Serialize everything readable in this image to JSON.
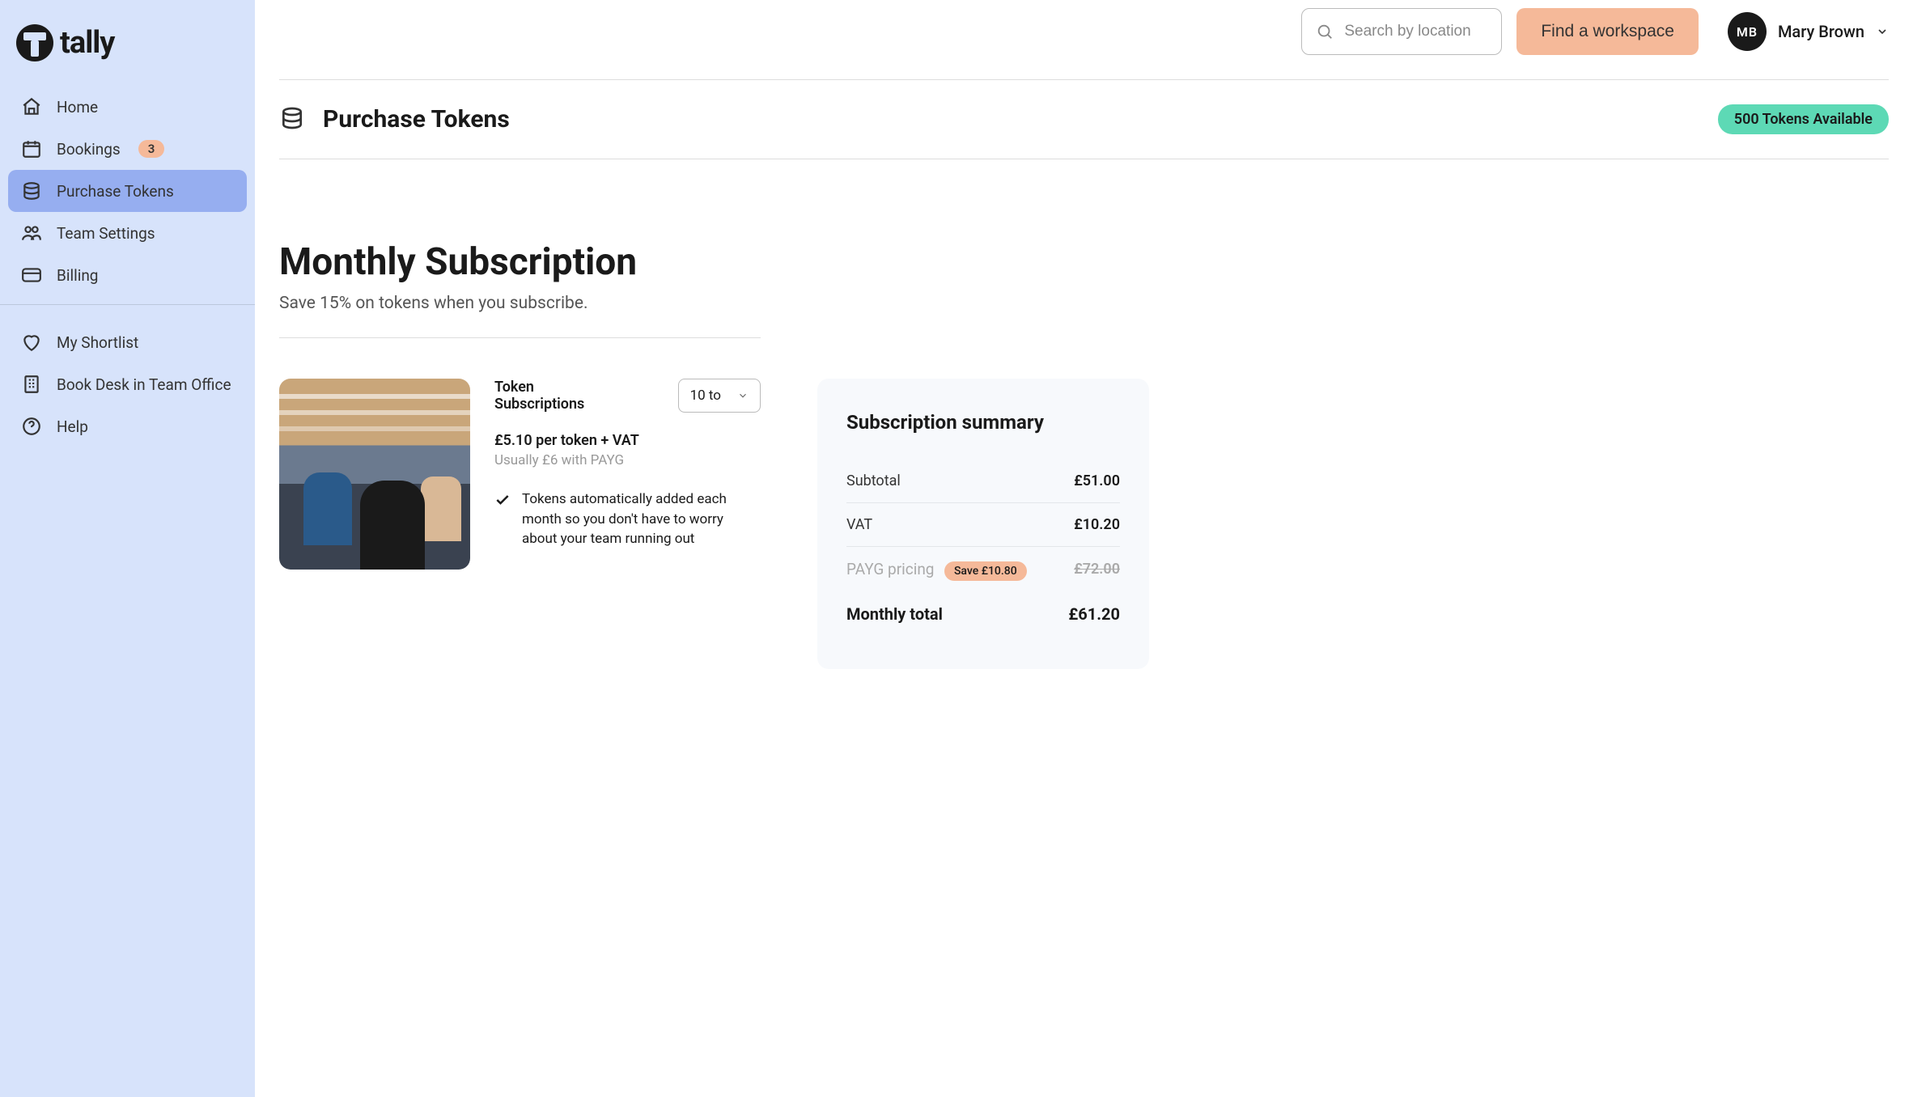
{
  "brand": {
    "name": "tally"
  },
  "sidebar": {
    "items": [
      {
        "label": "Home",
        "name": "home"
      },
      {
        "label": "Bookings",
        "name": "bookings",
        "badge": "3"
      },
      {
        "label": "Purchase Tokens",
        "name": "purchase-tokens",
        "active": true
      },
      {
        "label": "Team Settings",
        "name": "team-settings"
      },
      {
        "label": "Billing",
        "name": "billing"
      }
    ],
    "items2": [
      {
        "label": "My Shortlist",
        "name": "shortlist"
      },
      {
        "label": "Book Desk in Team Office",
        "name": "book-desk"
      },
      {
        "label": "Help",
        "name": "help"
      }
    ]
  },
  "topbar": {
    "search_placeholder": "Search by location",
    "cta": "Find a workspace",
    "user_initials": "MB",
    "user_name": "Mary Brown"
  },
  "page": {
    "title": "Purchase Tokens",
    "token_status": "500 Tokens Available"
  },
  "subscription": {
    "title": "Monthly Subscription",
    "subtitle": "Save 15% on tokens when you subscribe.",
    "token_label": "Token Subscriptions",
    "select_value": "10 to",
    "price_line": "£5.10 per token + VAT",
    "price_usual": "Usually £6 with PAYG",
    "feature1": "Tokens automatically added each month so you don't have to worry about your team running out"
  },
  "summary": {
    "title": "Subscription summary",
    "subtotal_label": "Subtotal",
    "subtotal_val": "£51.00",
    "vat_label": "VAT",
    "vat_val": "£10.20",
    "payg_label": "PAYG pricing",
    "save_label": "Save £10.80",
    "payg_val": "£72.00",
    "total_label": "Monthly total",
    "total_val": "£61.20"
  }
}
